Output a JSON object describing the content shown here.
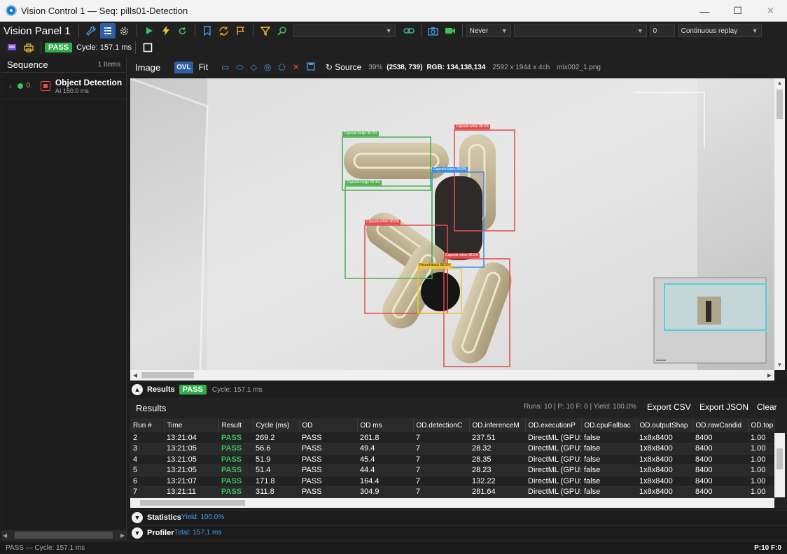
{
  "window": {
    "title": "Vision Control 1 — Seq: pills01-Detection",
    "controls": {
      "minimize": "—",
      "maximize": "☐",
      "close": "✕"
    }
  },
  "toolbar": {
    "panel_title": "Vision Panel 1",
    "icons": [
      "wrench-icon",
      "list-icon",
      "gear-icon",
      "play-icon",
      "lightning-icon",
      "refresh-icon",
      "bookmark-icon",
      "loop-icon",
      "flag-icon",
      "filter-icon",
      "search-icon",
      "link-icon",
      "camera-icon",
      "video-icon"
    ],
    "combo_empty": "",
    "trigger_select": "Never",
    "counter_value": "0",
    "replay_mode": "Continuous replay"
  },
  "status_row": {
    "result": "PASS",
    "cycle": "Cycle: 157.1 ms"
  },
  "sequence": {
    "title": "Sequence",
    "count": "1 items",
    "items": [
      {
        "index": "0.",
        "name": "Object Detection",
        "sub": "AI    150.0 ms"
      }
    ]
  },
  "image_panel": {
    "title": "Image",
    "overlay_button": "OVL",
    "fit_label": "Fit",
    "source_label": "Source",
    "zoom": "39%",
    "coords": "(2538, 739)",
    "rgb": "RGB: 134,138,134",
    "dims": "2592 x 1944 x 4ch",
    "filename": "mix002_1.png"
  },
  "detections": [
    {
      "label": "Capsule-beige 96.6%",
      "color": "#4caf50"
    },
    {
      "label": "Capsule-beige 93.4%",
      "color": "#4caf50"
    },
    {
      "label": "Capsule-white 98.4%",
      "color": "#e14c4c"
    },
    {
      "label": "Capsule-black 98.8%",
      "color": "#3a8ee6"
    },
    {
      "label": "Capsule-white 98.6%",
      "color": "#e14c4c"
    },
    {
      "label": "Capsule-white 98.6%",
      "color": "#e14c4c"
    },
    {
      "label": "Round-black 98.6%",
      "color": "#f0c430"
    }
  ],
  "results_bar": {
    "title": "Results",
    "badge": "PASS",
    "cycle": "Cycle: 157.1 ms"
  },
  "results": {
    "title": "Results",
    "stats": "Runs: 10  |  P: 10  F: 0  |  Yield: 100.0%",
    "export_csv": "Export CSV",
    "export_json": "Export JSON",
    "clear": "Clear",
    "columns": [
      "Run #",
      "Time",
      "Result",
      "Cycle (ms)",
      "OD",
      "OD ms",
      "OD.detectionC",
      "OD.inferenceM",
      "OD.executionP",
      "OD.cpuFallbac",
      "OD.outputShap",
      "OD.rawCandid",
      "OD.top"
    ],
    "rows": [
      [
        "2",
        "13:21:04",
        "PASS",
        "269.2",
        "PASS",
        "261.8",
        "7",
        "237.51",
        "DirectML (GPU:(",
        "false",
        "1x8x8400",
        "8400",
        "1.00"
      ],
      [
        "3",
        "13:21:05",
        "PASS",
        "56.6",
        "PASS",
        "49.4",
        "7",
        "28.32",
        "DirectML (GPU:(",
        "false",
        "1x8x8400",
        "8400",
        "1.00"
      ],
      [
        "4",
        "13:21:05",
        "PASS",
        "51.9",
        "PASS",
        "45.4",
        "7",
        "28.35",
        "DirectML (GPU:(",
        "false",
        "1x8x8400",
        "8400",
        "1.00"
      ],
      [
        "5",
        "13:21:05",
        "PASS",
        "51.4",
        "PASS",
        "44.4",
        "7",
        "28.23",
        "DirectML (GPU:(",
        "false",
        "1x8x8400",
        "8400",
        "1.00"
      ],
      [
        "6",
        "13:21:07",
        "PASS",
        "171.8",
        "PASS",
        "164.4",
        "7",
        "132.22",
        "DirectML (GPU:(",
        "false",
        "1x8x8400",
        "8400",
        "1.00"
      ],
      [
        "7",
        "13:21:11",
        "PASS",
        "311.8",
        "PASS",
        "304.9",
        "7",
        "281.64",
        "DirectML (GPU:(",
        "false",
        "1x8x8400",
        "8400",
        "1.00"
      ]
    ]
  },
  "statistics": {
    "title": "Statistics",
    "sub": "Yield: 100.0%"
  },
  "profiler": {
    "title": "Profiler",
    "sub": "Total: 157.1 ms"
  },
  "statusbar": {
    "left": "PASS — Cycle: 157.1 ms",
    "right_p": "P:10",
    "right_f": "F:0"
  }
}
